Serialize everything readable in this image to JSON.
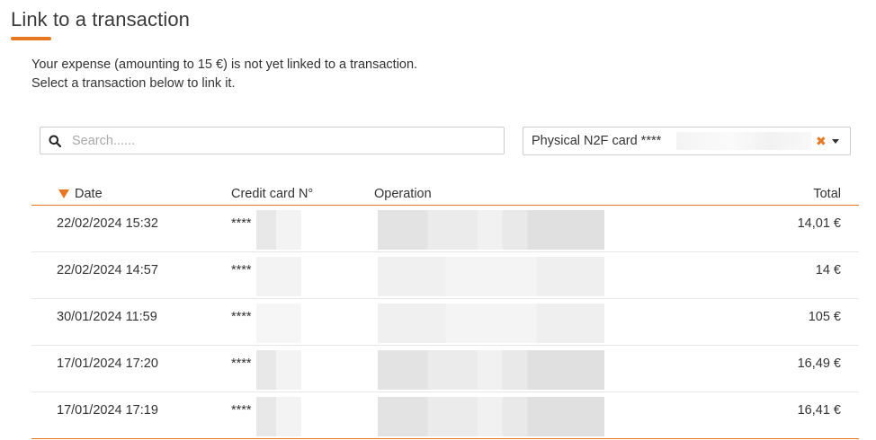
{
  "page": {
    "title": "Link to a transaction",
    "intro_line1": "Your expense (amounting to 15 €) is not yet linked to a transaction.",
    "intro_line2": "Select a transaction below to link it.",
    "accent_color": "#e87722"
  },
  "search": {
    "placeholder": "Search......",
    "value": ""
  },
  "card_filter": {
    "selected": "Physical N2F card ****"
  },
  "table": {
    "headers": {
      "date": "Date",
      "card": "Credit card N°",
      "operation": "Operation",
      "total": "Total"
    },
    "sort": {
      "column": "date",
      "direction": "descending"
    },
    "rows": [
      {
        "date": "22/02/2024 15:32",
        "card": "****",
        "operation": "",
        "total": "14,01 €"
      },
      {
        "date": "22/02/2024 14:57",
        "card": "****",
        "operation": "",
        "total": "14 €"
      },
      {
        "date": "30/01/2024 11:59",
        "card": "****",
        "operation": "",
        "total": "105 €"
      },
      {
        "date": "17/01/2024 17:20",
        "card": "****",
        "operation": "",
        "total": "16,49 €"
      },
      {
        "date": "17/01/2024 17:19",
        "card": "****",
        "operation": "",
        "total": "16,41 €"
      }
    ]
  }
}
